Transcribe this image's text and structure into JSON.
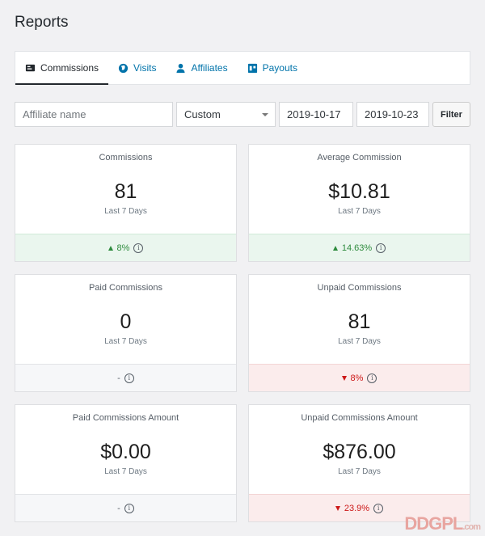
{
  "page": {
    "title": "Reports"
  },
  "tabs": [
    {
      "label": "Commissions",
      "icon": "commissions-icon",
      "active": true
    },
    {
      "label": "Visits",
      "icon": "globe-icon",
      "active": false
    },
    {
      "label": "Affiliates",
      "icon": "user-icon",
      "active": false
    },
    {
      "label": "Payouts",
      "icon": "payouts-icon",
      "active": false
    }
  ],
  "filters": {
    "affiliate_placeholder": "Affiliate name",
    "range_selected": "Custom",
    "date_from": "2019-10-17",
    "date_to": "2019-10-23",
    "filter_label": "Filter"
  },
  "cards": [
    {
      "label": "Commissions",
      "value": "81",
      "period": "Last 7 Days",
      "trend": "up",
      "change": "8%"
    },
    {
      "label": "Average Commission",
      "value": "$10.81",
      "period": "Last 7 Days",
      "trend": "up",
      "change": "14.63%"
    },
    {
      "label": "Paid Commissions",
      "value": "0",
      "period": "Last 7 Days",
      "trend": "neutral",
      "change": "-"
    },
    {
      "label": "Unpaid Commissions",
      "value": "81",
      "period": "Last 7 Days",
      "trend": "down",
      "change": "8%"
    },
    {
      "label": "Paid Commissions Amount",
      "value": "$0.00",
      "period": "Last 7 Days",
      "trend": "neutral",
      "change": "-"
    },
    {
      "label": "Unpaid Commissions Amount",
      "value": "$876.00",
      "period": "Last 7 Days",
      "trend": "down",
      "change": "23.9%"
    }
  ],
  "colors": {
    "accent": "#0073aa",
    "up": "#2e8b3d",
    "down": "#cc1818",
    "up_bg": "#eaf6ee",
    "down_bg": "#fbecec"
  },
  "watermark": {
    "brand": "DDGPL",
    "suffix": ".com"
  }
}
